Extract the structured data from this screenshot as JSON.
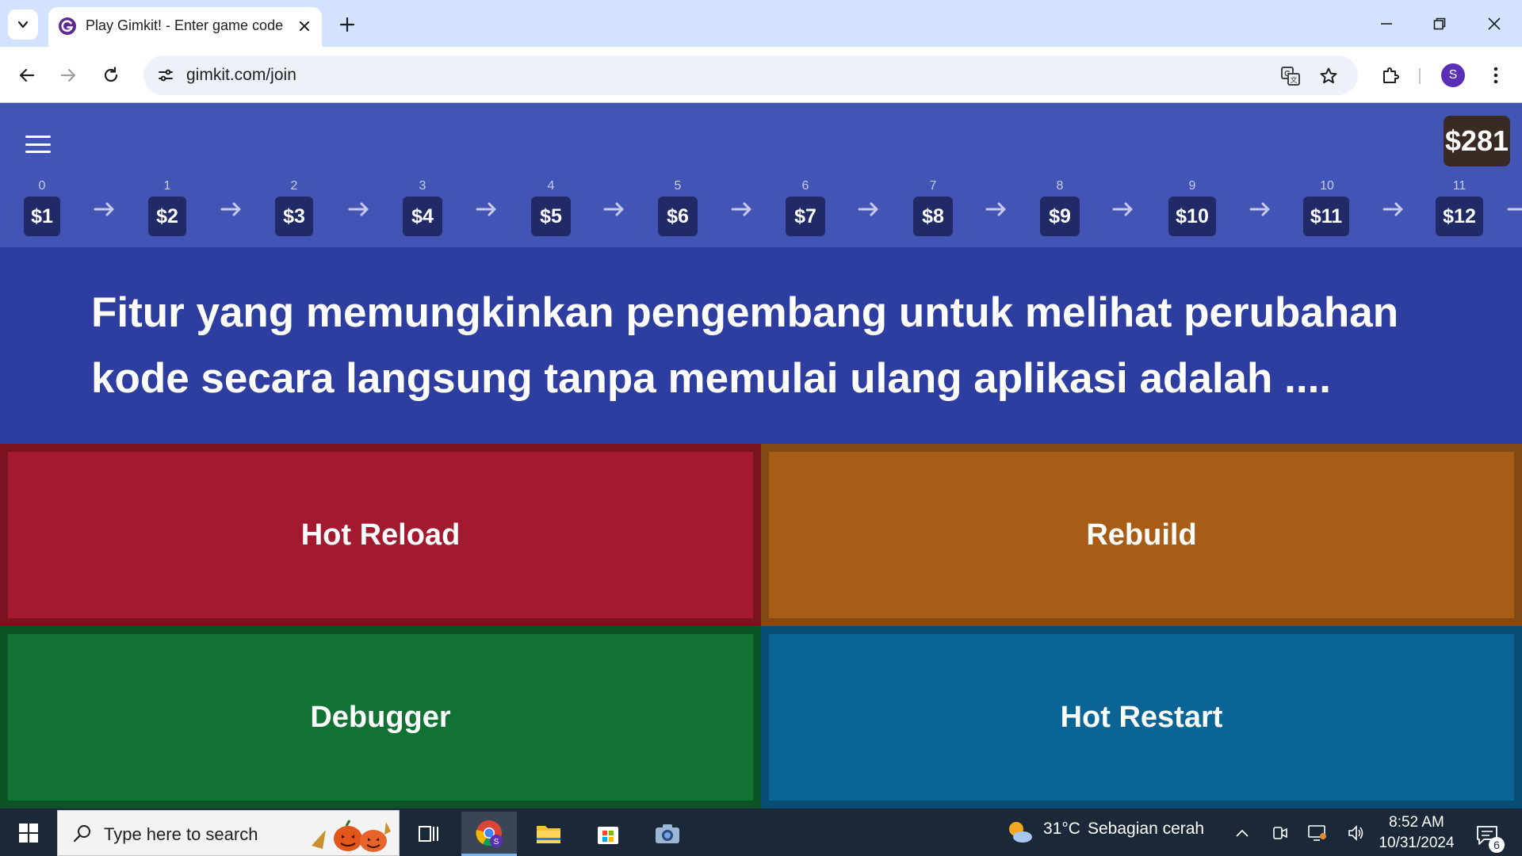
{
  "browser": {
    "tab_title": "Play Gimkit! - Enter game code",
    "url": "gimkit.com/join",
    "profile_initial": "S"
  },
  "game": {
    "balance": "$281",
    "levels": [
      {
        "index": "0",
        "price": "$1"
      },
      {
        "index": "1",
        "price": "$2"
      },
      {
        "index": "2",
        "price": "$3"
      },
      {
        "index": "3",
        "price": "$4"
      },
      {
        "index": "4",
        "price": "$5"
      },
      {
        "index": "5",
        "price": "$6"
      },
      {
        "index": "6",
        "price": "$7"
      },
      {
        "index": "7",
        "price": "$8"
      },
      {
        "index": "8",
        "price": "$9"
      },
      {
        "index": "9",
        "price": "$10"
      },
      {
        "index": "10",
        "price": "$11"
      },
      {
        "index": "11",
        "price": "$12"
      }
    ],
    "question": "Fitur yang memungkinkan pengembang untuk melihat perubahan kode secara langsung tanpa memulai ulang aplikasi adalah ....",
    "answers": [
      {
        "label": "Hot Reload",
        "color": "#a3192f",
        "border": "#7a1220"
      },
      {
        "label": "Rebuild",
        "color": "#a85d16",
        "border": "#834a16"
      },
      {
        "label": "Debugger",
        "color": "#117234",
        "border": "#0c5326"
      },
      {
        "label": "Hot Restart",
        "color": "#0a6495",
        "border": "#084d74"
      }
    ]
  },
  "taskbar": {
    "search_placeholder": "Type here to search",
    "weather_temp": "31°C",
    "weather_desc": "Sebagian cerah",
    "time": "8:52 AM",
    "date": "10/31/2024",
    "notification_count": "6"
  }
}
